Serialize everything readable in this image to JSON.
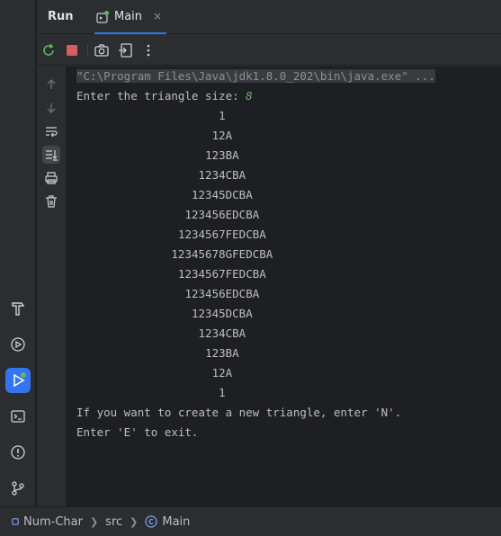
{
  "window": {
    "run_title": "Run",
    "tab_label": "Main",
    "tab_close": "×"
  },
  "console": {
    "command": "\"C:\\Program Files\\Java\\jdk1.8.0_202\\bin\\java.exe\" ...",
    "prompt": "Enter the triangle size: ",
    "input_value": "8",
    "triangle": [
      "1",
      "12A",
      "123BA",
      "1234CBA",
      "12345DCBA",
      "123456EDCBA",
      "1234567FEDCBA",
      "12345678GFEDCBA",
      "1234567FEDCBA",
      "123456EDCBA",
      "12345DCBA",
      "1234CBA",
      "123BA",
      "12A",
      "1"
    ],
    "footer_lines": [
      "If you want to create a new triangle, enter 'N'.",
      "Enter 'E' to exit."
    ]
  },
  "statusbar": {
    "project": "Num-Char",
    "folder": "src",
    "file": "Main"
  },
  "colors": {
    "accent": "#3574f0",
    "input_green": "#6aab73",
    "stop_red": "#db5c5c",
    "run_green": "#5fb865"
  },
  "icons": {
    "stripe": [
      "hammer-icon",
      "debug-icon",
      "run-icon",
      "terminal-icon",
      "problems-icon",
      "git-icon"
    ],
    "toolbar": [
      "rerun-icon",
      "stop-icon",
      "camera-icon",
      "exit-icon",
      "more-icon"
    ],
    "console_side": [
      "up-arrow-icon",
      "down-arrow-icon",
      "soft-wrap-icon",
      "scroll-to-end-icon",
      "print-icon",
      "trash-icon"
    ]
  }
}
